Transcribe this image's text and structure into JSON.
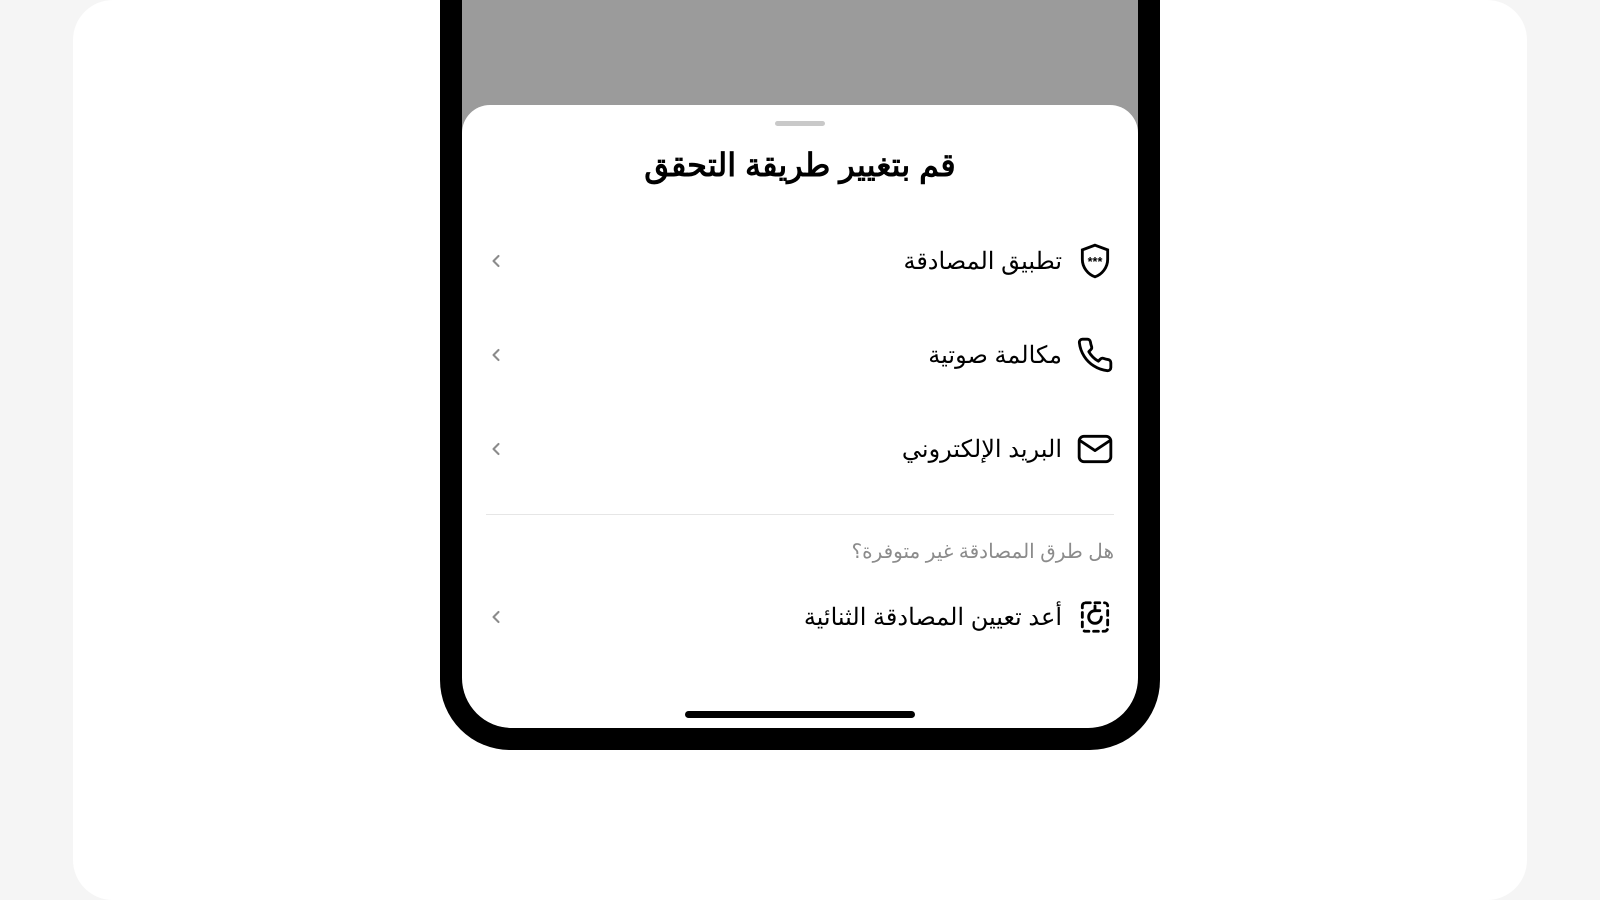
{
  "sheet": {
    "title": "قم بتغيير طريقة التحقق",
    "options": [
      {
        "label": "تطبيق المصادقة"
      },
      {
        "label": "مكالمة صوتية"
      },
      {
        "label": "البريد الإلكتروني"
      }
    ],
    "unavailable_prompt": "هل طرق المصادقة غير متوفرة؟",
    "reset": {
      "label": "أعد تعيين المصادقة الثنائية"
    }
  }
}
